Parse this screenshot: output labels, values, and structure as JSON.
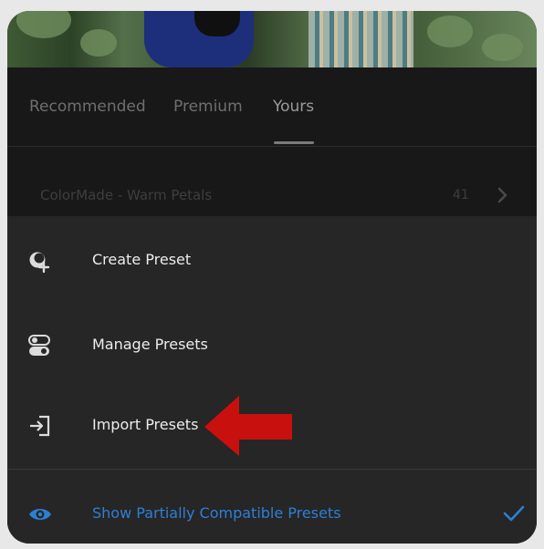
{
  "tabs": [
    {
      "label": "Recommended",
      "active": false
    },
    {
      "label": "Premium",
      "active": false
    },
    {
      "label": "Yours",
      "active": true
    }
  ],
  "preset_group": {
    "name": "ColorMade - Warm Petals",
    "count": "41"
  },
  "menu": {
    "create_label": "Create Preset",
    "manage_label": "Manage Presets",
    "import_label": "Import Presets",
    "compat_label": "Show Partially Compatible Presets",
    "compat_checked": true
  },
  "colors": {
    "accent_blue": "#2d7fd6",
    "annotation_red": "#c8100e",
    "sheet_bg": "#262626"
  },
  "icons": {
    "create": "create-preset-icon",
    "manage": "toggle-switches-icon",
    "import": "import-icon",
    "compat": "eye-icon",
    "check": "checkmark-icon",
    "chevron": "chevron-right-icon",
    "annotation": "red-arrow-icon"
  }
}
